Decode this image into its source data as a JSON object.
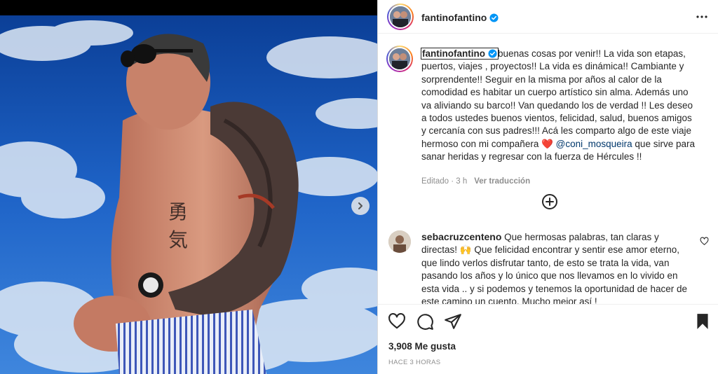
{
  "post": {
    "author": "fantinofantino",
    "caption_username": "fantinofantino",
    "caption_part1": "buenas cosas por venir!! La vida son etapas, puertos, viajes , proyectos!! La vida es dinámica!! Cambiante y sorprendente!! Seguir en la misma por años al calor de la comodidad es habitar un cuerpo artístico sin alma. Además uno va aliviando su barco!! Van quedando los de verdad !! Les deseo a todos ustedes buenos vientos, felicidad, salud, buenos amigos y cercanía con sus padres!!! Acá les comparto algo de este viaje hermoso con mi compañera ",
    "caption_heart": "❤️",
    "caption_mention": "@coni_mosqueira",
    "caption_part2": " que sirve para sanar heridas y regresar con la fuerza de Hércules !!",
    "edited_label": "Editado · 3 h",
    "see_translation": "Ver traducción",
    "likes": "3,908 Me gusta",
    "time_ago": "HACE 3 HORAS"
  },
  "comment": {
    "username": "sebacruzcenteno",
    "text": " Que hermosas palabras, tan claras y directas! 🙌 Que felicidad encontrar y sentir ese amor eterno, que lindo verlos disfrutar tanto, de esto se trata la vida, van pasando los años y lo único que nos llevamos en lo vivido en esta vida .. y si podemos y tenemos la oportunidad de hacer de este camino un cuento. Mucho mejor así !"
  },
  "icons": {
    "verified": "verified-badge-icon",
    "more": "more-options-icon",
    "load_more": "plus-circle-icon",
    "like": "heart-icon",
    "comment": "comment-bubble-icon",
    "share": "paper-plane-icon",
    "save": "bookmark-icon",
    "next": "chevron-right-icon"
  },
  "colors": {
    "verified_blue": "#0095f6",
    "mention": "#00376b",
    "secondary_text": "#8e8e8e",
    "heart_red": "#d9202a"
  }
}
